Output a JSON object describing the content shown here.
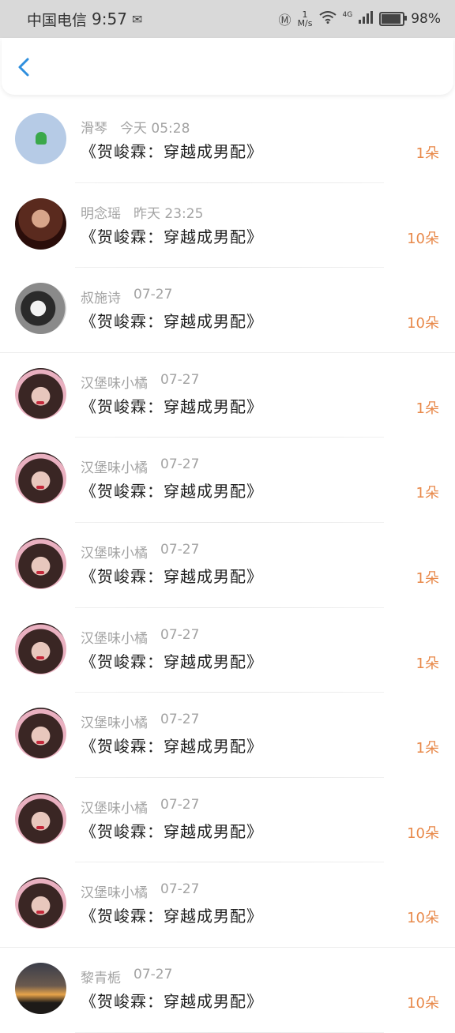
{
  "status_bar": {
    "carrier": "中国电信",
    "time": "9:57",
    "speed_value": "1",
    "speed_unit": "M/s",
    "network": "4G",
    "battery_percent": "98%",
    "battery_level": 0.98,
    "icons": [
      "message-icon",
      "hd-icon",
      "wifi-icon",
      "signal-icon",
      "battery-icon"
    ]
  },
  "header": {
    "back_icon": "chevron-left-icon",
    "accent_color": "#2f8fde"
  },
  "colors": {
    "amount": "#e8894a",
    "meta": "#a3a3a3",
    "title": "#222222"
  },
  "records": [
    {
      "name": "滑琴",
      "time": "今天 05:28",
      "title": "《贺峻霖：穿越成男配》",
      "amount": "1朵",
      "avatar": "android-avatar"
    },
    {
      "name": "明念瑶",
      "time": "昨天 23:25",
      "title": "《贺峻霖：穿越成男配》",
      "amount": "10朵",
      "avatar": "woman-avatar"
    },
    {
      "name": "叔施诗",
      "time": "07-27",
      "title": "《贺峻霖：穿越成男配》",
      "amount": "10朵",
      "avatar": "masked-person-avatar"
    },
    {
      "name": "汉堡味小橘",
      "time": "07-27",
      "title": "《贺峻霖：穿越成男配》",
      "amount": "1朵",
      "avatar": "girl-avatar"
    },
    {
      "name": "汉堡味小橘",
      "time": "07-27",
      "title": "《贺峻霖：穿越成男配》",
      "amount": "1朵",
      "avatar": "girl-avatar"
    },
    {
      "name": "汉堡味小橘",
      "time": "07-27",
      "title": "《贺峻霖：穿越成男配》",
      "amount": "1朵",
      "avatar": "girl-avatar"
    },
    {
      "name": "汉堡味小橘",
      "time": "07-27",
      "title": "《贺峻霖：穿越成男配》",
      "amount": "1朵",
      "avatar": "girl-avatar"
    },
    {
      "name": "汉堡味小橘",
      "time": "07-27",
      "title": "《贺峻霖：穿越成男配》",
      "amount": "1朵",
      "avatar": "girl-avatar"
    },
    {
      "name": "汉堡味小橘",
      "time": "07-27",
      "title": "《贺峻霖：穿越成男配》",
      "amount": "10朵",
      "avatar": "girl-avatar"
    },
    {
      "name": "汉堡味小橘",
      "time": "07-27",
      "title": "《贺峻霖：穿越成男配》",
      "amount": "10朵",
      "avatar": "girl-avatar"
    },
    {
      "name": "黎青栀",
      "time": "07-27",
      "title": "《贺峻霖：穿越成男配》",
      "amount": "10朵",
      "avatar": "sunset-avatar"
    }
  ]
}
